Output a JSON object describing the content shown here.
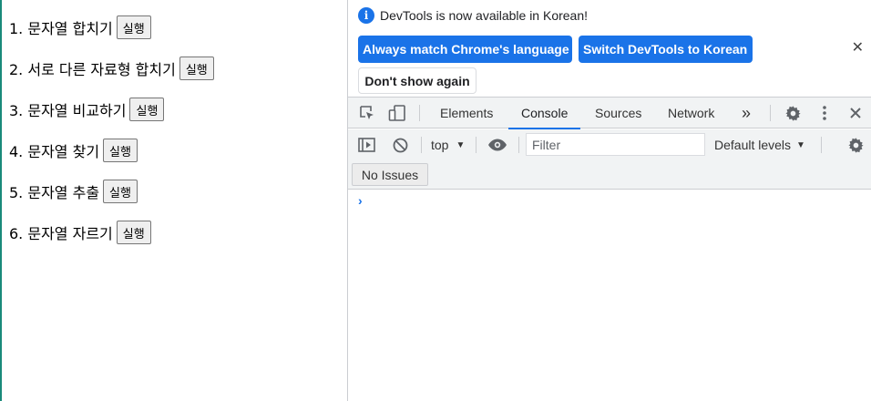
{
  "page": {
    "rows": [
      {
        "label": "1. 문자열 합치기",
        "button": "실행"
      },
      {
        "label": "2. 서로 다른 자료형 합치기",
        "button": "실행"
      },
      {
        "label": "3. 문자열 비교하기",
        "button": "실행"
      },
      {
        "label": "4. 문자열 찾기",
        "button": "실행"
      },
      {
        "label": "5. 문자열 추출",
        "button": "실행"
      },
      {
        "label": "6. 문자열 자르기",
        "button": "실행"
      }
    ]
  },
  "devtools": {
    "info": {
      "message": "DevTools is now available in Korean!",
      "match_label": "Always match Chrome's language",
      "switch_label": "Switch DevTools to Korean",
      "dont_show_label": "Don't show again",
      "close_glyph": "✕"
    },
    "tabs": [
      "Elements",
      "Console",
      "Sources",
      "Network"
    ],
    "active_tab": "Console",
    "more_tabs_glyph": "»",
    "toolbar": {
      "context": "top",
      "filter_placeholder": "Filter",
      "levels": "Default levels"
    },
    "issues_label": "No Issues",
    "prompt_glyph": "›",
    "accent_color": "#1a73e8"
  }
}
